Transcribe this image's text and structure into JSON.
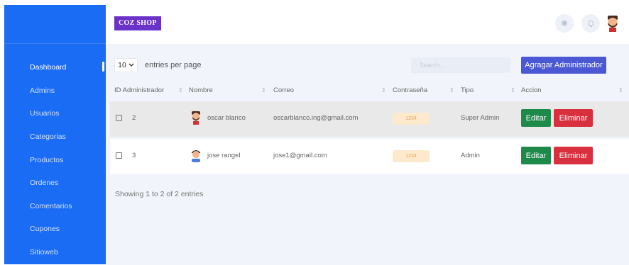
{
  "brand": {
    "name": "COZ SHOP"
  },
  "sidebar": {
    "items": [
      {
        "label": "Dashboard",
        "active": true
      },
      {
        "label": "Admins"
      },
      {
        "label": "Usuarios"
      },
      {
        "label": "Categorias"
      },
      {
        "label": "Productos"
      },
      {
        "label": "Ordenes"
      },
      {
        "label": "Comentarios"
      },
      {
        "label": "Cupones"
      },
      {
        "label": "Sitioweb"
      }
    ]
  },
  "topbar": {
    "icons": [
      "sun-icon",
      "bell-icon",
      "user-avatar"
    ]
  },
  "table_controls": {
    "entries_value": "10",
    "entries_label": "entries per page",
    "search_placeholder": "Search...",
    "add_button": "Agragar Administrador"
  },
  "table": {
    "columns": [
      "ID Administrador",
      "Nombre",
      "Correo",
      "Contraseña",
      "Tipo",
      "Accion"
    ],
    "rows": [
      {
        "id": "2",
        "nombre": "oscar blanco",
        "correo": "oscarblanco.ing@gmail.com",
        "contrasena": "1234",
        "tipo": "Super Admin",
        "edit": "Editar",
        "delete": "Eliminar"
      },
      {
        "id": "3",
        "nombre": "jose rangel",
        "correo": "jose1@gmail.com",
        "contrasena": "1234",
        "tipo": "Admin",
        "edit": "Editar",
        "delete": "Eliminar"
      }
    ]
  },
  "footer": {
    "showing": "Showing 1 to 2 of 2 entries"
  },
  "colors": {
    "sidebar": "#1a6cf5",
    "brand": "#6a32c9",
    "primary_button": "#4a58d4",
    "edit": "#1e8a4a",
    "delete": "#d8303f"
  }
}
